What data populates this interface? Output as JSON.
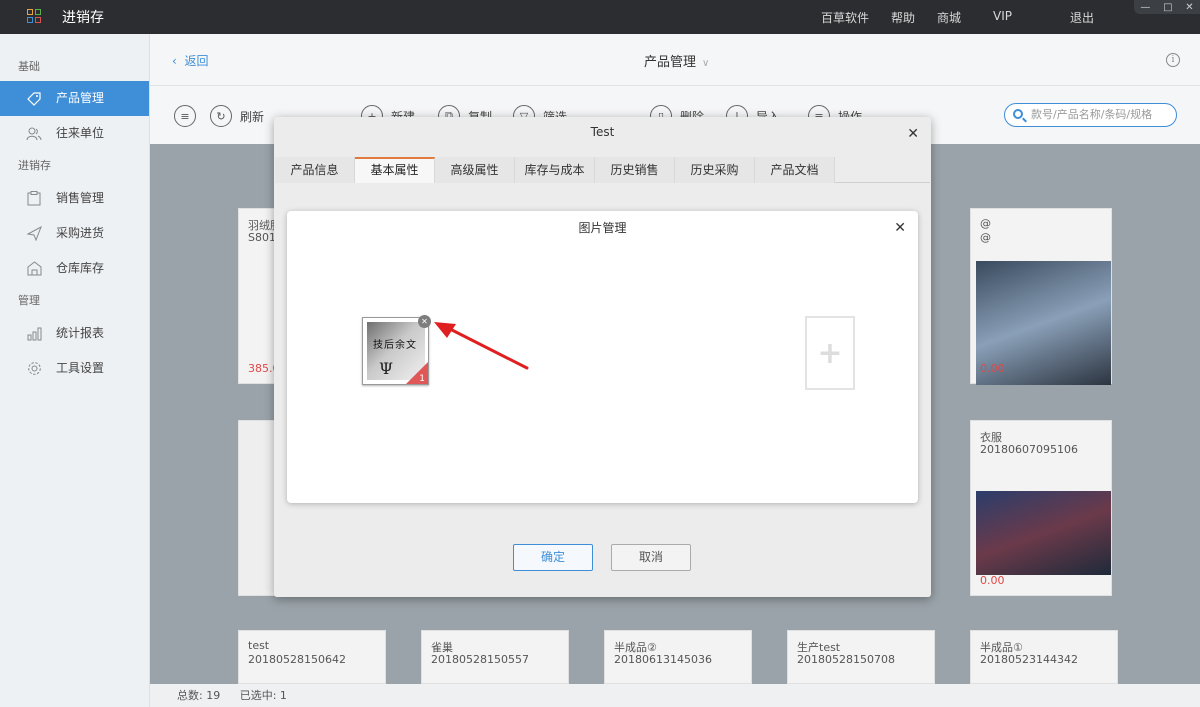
{
  "titlebar": {
    "app_title": "进销存",
    "links": [
      "百草软件",
      "帮助",
      "商城",
      "VIP",
      "退出"
    ]
  },
  "sidebar": {
    "sections": [
      {
        "label": "基础",
        "items": [
          {
            "label": "产品管理",
            "icon": "tag-icon",
            "active": true
          },
          {
            "label": "往来单位",
            "icon": "users-icon",
            "active": false
          }
        ]
      },
      {
        "label": "进销存",
        "items": [
          {
            "label": "销售管理",
            "icon": "clipboard-icon",
            "active": false
          },
          {
            "label": "采购进货",
            "icon": "plane-icon",
            "active": false
          },
          {
            "label": "仓库库存",
            "icon": "warehouse-icon",
            "active": false
          }
        ]
      },
      {
        "label": "管理",
        "items": [
          {
            "label": "统计报表",
            "icon": "bar-chart-icon",
            "active": false
          },
          {
            "label": "工具设置",
            "icon": "gear-icon",
            "active": false
          }
        ]
      }
    ]
  },
  "header": {
    "back_label": "返回",
    "page_title": "产品管理"
  },
  "toolbar": {
    "refresh": "刷新",
    "new": "新建",
    "copy": "复制",
    "filter": "筛选",
    "delete": "删除",
    "import": "导入",
    "operate": "操作",
    "search_placeholder": "款号/产品名称/条码/规格"
  },
  "cards": {
    "card1_name": "羽绒服",
    "card1_code": "S801",
    "card1_price": "385.0",
    "card_right1_name": "@",
    "card_right1_code": "@",
    "card_right1_price": "0.00",
    "card_right2_name": "衣服",
    "card_right2_code": "20180607095106",
    "card_right2_price": "0.00",
    "bottom": [
      {
        "name": "test",
        "code": "20180528150642"
      },
      {
        "name": "雀巢",
        "code": "20180528150557"
      },
      {
        "name": "半成品②",
        "code": "20180613145036"
      },
      {
        "name": "生产test",
        "code": "20180528150708"
      },
      {
        "name": "半成品①",
        "code": "20180523144342"
      }
    ]
  },
  "footer": {
    "total": "总数: 19",
    "selected": "已选中: 1"
  },
  "modal": {
    "title": "Test",
    "tabs": [
      "产品信息",
      "基本属性",
      "高级属性",
      "库存与成本",
      "历史销售",
      "历史采购",
      "产品文档"
    ],
    "active_tab": "基本属性",
    "confirm": "确定",
    "cancel": "取消"
  },
  "image_modal": {
    "title": "图片管理",
    "image_index": "1",
    "image_caption": "技后余文"
  },
  "colors": {
    "accent": "#3e8ed8",
    "tab_active": "#e07a3e",
    "arrow": "#e02020",
    "price": "#e04848"
  }
}
